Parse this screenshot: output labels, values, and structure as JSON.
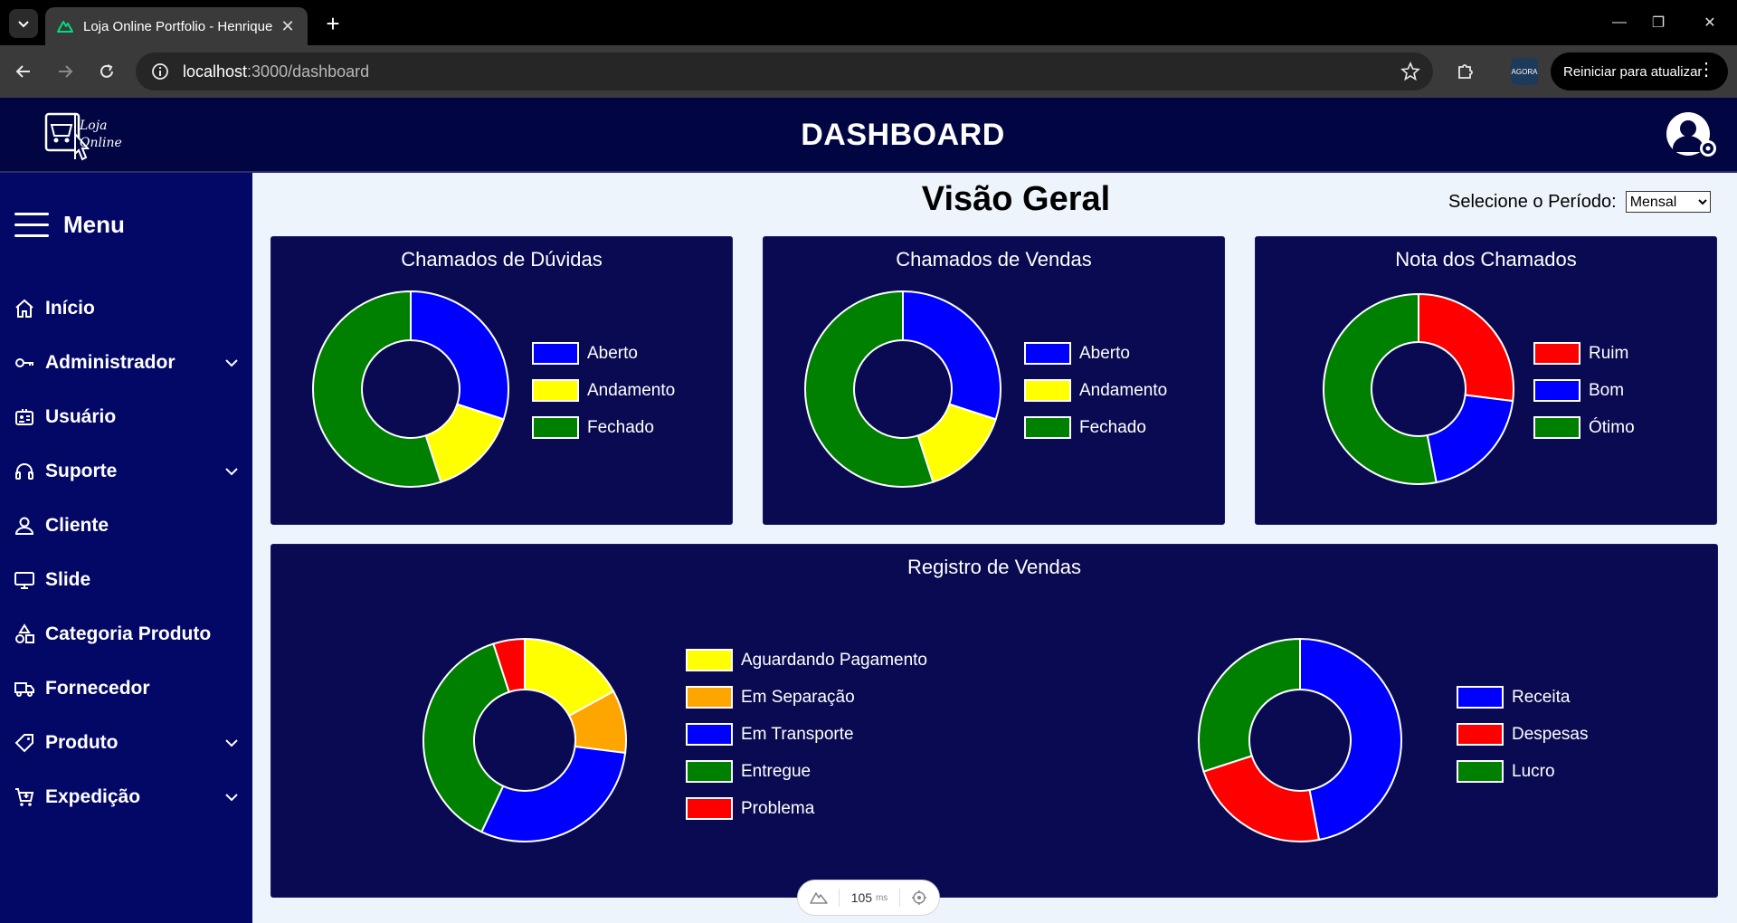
{
  "browser": {
    "tab_title": "Loja Online Portfolio - Henrique",
    "url_host": "localhost",
    "url_path": ":3000/dashboard",
    "update_button": "Reiniciar para atualizar",
    "profile_badge": "AGORA"
  },
  "header": {
    "logo_line1": "Loja",
    "logo_line2": "Online",
    "title": "DASHBOARD"
  },
  "sidebar": {
    "menu_label": "Menu",
    "items": [
      {
        "label": "Início",
        "icon": "home-icon",
        "has_submenu": false
      },
      {
        "label": "Administrador",
        "icon": "key-icon",
        "has_submenu": true
      },
      {
        "label": "Usuário",
        "icon": "id-card-icon",
        "has_submenu": false
      },
      {
        "label": "Suporte",
        "icon": "headset-icon",
        "has_submenu": true
      },
      {
        "label": "Cliente",
        "icon": "person-icon",
        "has_submenu": false
      },
      {
        "label": "Slide",
        "icon": "monitor-icon",
        "has_submenu": false
      },
      {
        "label": "Categoria Produto",
        "icon": "shapes-icon",
        "has_submenu": false
      },
      {
        "label": "Fornecedor",
        "icon": "truck-icon",
        "has_submenu": false
      },
      {
        "label": "Produto",
        "icon": "tag-icon",
        "has_submenu": true
      },
      {
        "label": "Expedição",
        "icon": "cart-icon",
        "has_submenu": true
      }
    ]
  },
  "main": {
    "title": "Visão Geral",
    "period_label": "Selecione o Período:",
    "period_value": "Mensal"
  },
  "devtools": {
    "timing_value": "105",
    "timing_unit": "ms"
  },
  "colors": {
    "blue": "#0000ff",
    "yellow": "#ffff00",
    "green": "#008000",
    "red": "#ff0000",
    "orange": "#ffa500",
    "card_bg": "#0a0a52",
    "sidebar_bg": "#030766",
    "header_bg": "#010542"
  },
  "chart_data": [
    {
      "type": "pie",
      "title": "Chamados de Dúvidas",
      "categories": [
        "Aberto",
        "Andamento",
        "Fechado"
      ],
      "values": [
        30,
        15,
        55
      ],
      "colors": [
        "#0000ff",
        "#ffff00",
        "#008000"
      ]
    },
    {
      "type": "pie",
      "title": "Chamados de Vendas",
      "categories": [
        "Aberto",
        "Andamento",
        "Fechado"
      ],
      "values": [
        30,
        15,
        55
      ],
      "colors": [
        "#0000ff",
        "#ffff00",
        "#008000"
      ]
    },
    {
      "type": "pie",
      "title": "Nota dos Chamados",
      "categories": [
        "Ruim",
        "Bom",
        "Ótimo"
      ],
      "values": [
        27,
        20,
        53
      ],
      "colors": [
        "#ff0000",
        "#0000ff",
        "#008000"
      ]
    },
    {
      "type": "pie",
      "title": "Registro de Vendas",
      "categories": [
        "Aguardando Pagamento",
        "Em Separação",
        "Em Transporte",
        "Entregue",
        "Problema"
      ],
      "values": [
        17,
        10,
        30,
        38,
        5
      ],
      "colors": [
        "#ffff00",
        "#ffa500",
        "#0000ff",
        "#008000",
        "#ff0000"
      ]
    },
    {
      "type": "pie",
      "title": "",
      "categories": [
        "Receita",
        "Despesas",
        "Lucro"
      ],
      "values": [
        47,
        23,
        30
      ],
      "colors": [
        "#0000ff",
        "#ff0000",
        "#008000"
      ]
    }
  ]
}
